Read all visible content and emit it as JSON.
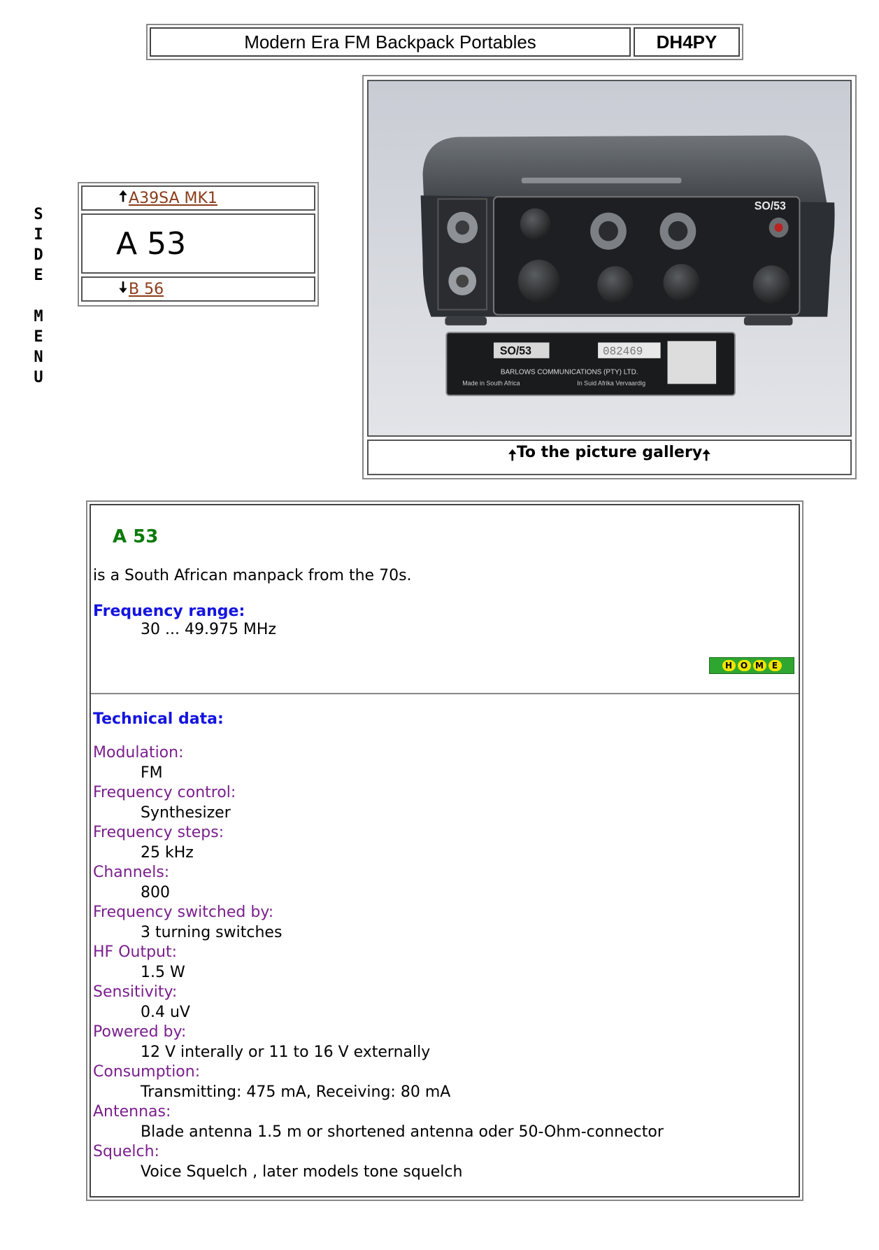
{
  "header": {
    "title": "Modern Era FM Backpack Portables",
    "callsign": "DH4PY"
  },
  "side_menu": {
    "letters": [
      "S",
      "I",
      "D",
      "E",
      "M",
      "E",
      "N",
      "U"
    ]
  },
  "nav": {
    "prev_label": "A39SA MK1",
    "current_label": "A 53",
    "next_label": "B 56",
    "up_arrow": "🠅",
    "down_arrow": "🠇"
  },
  "photo": {
    "plate_type": "SO/53",
    "plate_serial": "082469",
    "plate_maker": "BARLOWS COMMUNICATIONS (PTY) LTD.",
    "plate_made": "Made in South Africa",
    "plate_made_local": "In Suid Afrika Vervaardig",
    "panel_label": "SO/53",
    "gallery_label": "To the picture gallery"
  },
  "info": {
    "model": "A 53",
    "intro": "is a South African manpack from the 70s.",
    "freq_range_head": "Frequency range:",
    "freq_range": "30 ... 49.975 MHz",
    "home_letters": [
      "H",
      "O",
      "M",
      "E"
    ],
    "tech_head": "Technical data:",
    "specs": [
      {
        "label": "Modulation:",
        "value": "FM"
      },
      {
        "label": "Frequency control:",
        "value": "Synthesizer"
      },
      {
        "label": "Frequency steps:",
        "value": "25 kHz"
      },
      {
        "label": "Channels:",
        "value": "800"
      },
      {
        "label": "Frequency switched by:",
        "value": "3 turning switches"
      },
      {
        "label": "HF Output:",
        "value": "1.5 W"
      },
      {
        "label": "Sensitivity:",
        "value": "0.4 uV"
      },
      {
        "label": "Powered by:",
        "value": "12 V interally or 11 to 16 V externally"
      },
      {
        "label": "Consumption:",
        "value": "Transmitting: 475 mA, Receiving: 80 mA"
      },
      {
        "label": "Antennas:",
        "value": "Blade antenna 1.5 m or shortened antenna oder 50-Ohm-connector"
      },
      {
        "label": "Squelch:",
        "value": "Voice Squelch , later models tone squelch"
      }
    ]
  },
  "colors": {
    "link": "#8b3c1a",
    "heading_green": "#0a7a0a",
    "heading_blue": "#1414e0",
    "spec_label": "#7a1f8c"
  }
}
